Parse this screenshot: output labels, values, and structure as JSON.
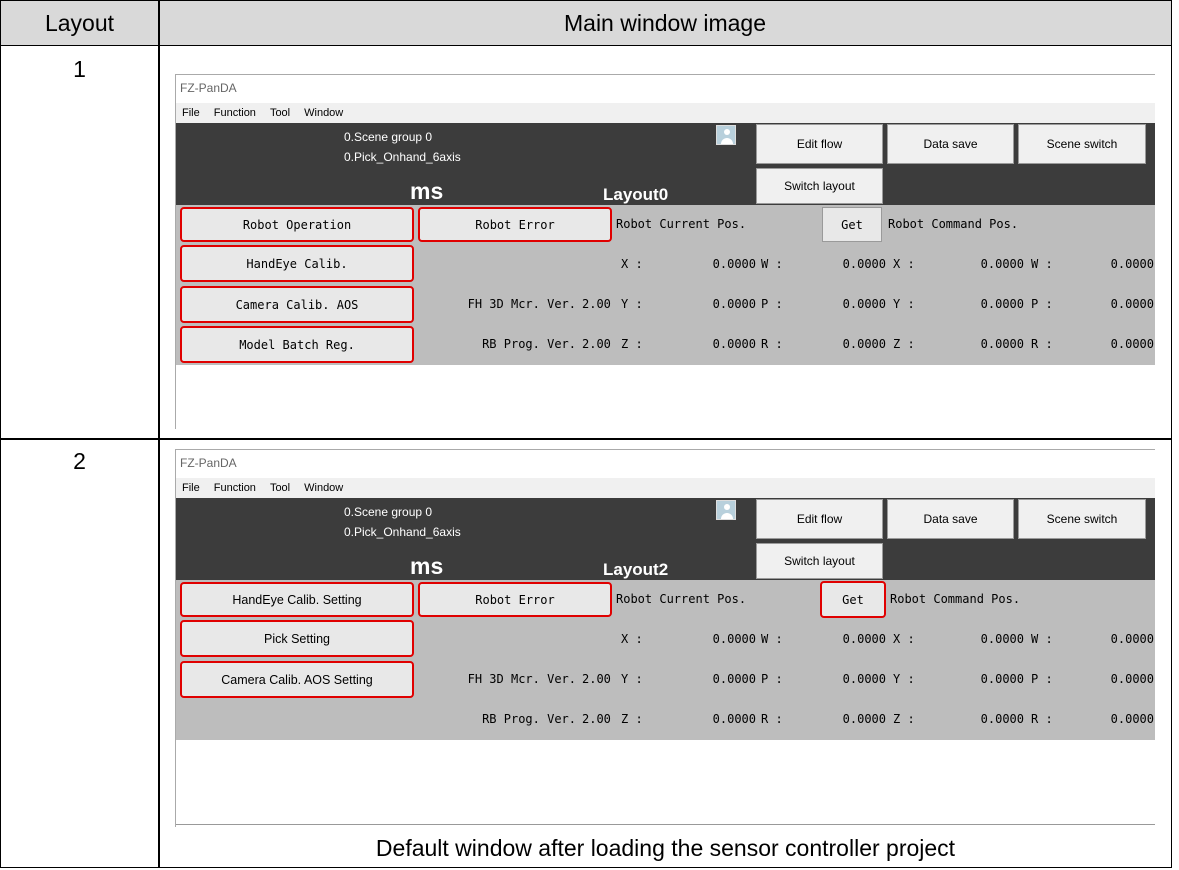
{
  "table": {
    "col_layout": "Layout",
    "col_image": "Main window image",
    "caption": "Default window after loading the sensor controller project"
  },
  "rows": [
    {
      "num": "1",
      "window": {
        "title": "FZ-PanDA",
        "menu": [
          "File",
          "Function",
          "Tool",
          "Window"
        ],
        "scene_group": "0.Scene group 0",
        "scene": "0.Pick_Onhand_6axis",
        "ms": "ms",
        "layout": "Layout0",
        "btn_edit_flow": "Edit flow",
        "btn_data_save": "Data save",
        "btn_scene_switch": "Scene switch",
        "btn_switch_layout": "Switch layout",
        "left_buttons": [
          "Robot Operation",
          "HandEye Calib.",
          "Camera Calib. AOS",
          "Model Batch Reg."
        ],
        "robot_error": "Robot Error",
        "current_pos": "Robot Current Pos.",
        "get": "Get",
        "command_pos": "Robot Command Pos.",
        "fh_ver_label": "FH 3D Mcr. Ver.",
        "fh_ver": "2.00",
        "rb_ver_label": "RB Prog. Ver.",
        "rb_ver": "2.00",
        "axes_a": [
          "X :",
          "Y :",
          "Z :"
        ],
        "axes_b": [
          "W :",
          "P :",
          "R :"
        ],
        "values": "0.0000"
      }
    },
    {
      "num": "2",
      "window": {
        "title": "FZ-PanDA",
        "menu": [
          "File",
          "Function",
          "Tool",
          "Window"
        ],
        "scene_group": "0.Scene group 0",
        "scene": "0.Pick_Onhand_6axis",
        "ms": "ms",
        "layout": "Layout2",
        "btn_edit_flow": "Edit flow",
        "btn_data_save": "Data save",
        "btn_scene_switch": "Scene switch",
        "btn_switch_layout": "Switch layout",
        "left_buttons": [
          "HandEye Calib. Setting",
          "Pick Setting",
          "Camera Calib. AOS  Setting"
        ],
        "robot_error": "Robot Error",
        "current_pos": "Robot Current Pos.",
        "get": "Get",
        "command_pos": "Robot Command Pos.",
        "fh_ver_label": "FH 3D Mcr. Ver.",
        "fh_ver": "2.00",
        "rb_ver_label": "RB Prog. Ver.",
        "rb_ver": "2.00",
        "axes_a": [
          "X :",
          "Y :",
          "Z :"
        ],
        "axes_b": [
          "W :",
          "P :",
          "R :"
        ],
        "values": "0.0000"
      }
    }
  ],
  "colors": {
    "highlight": "#e00000",
    "dark_panel": "#3c3c3c",
    "gray_panel": "#bdbdbd"
  }
}
